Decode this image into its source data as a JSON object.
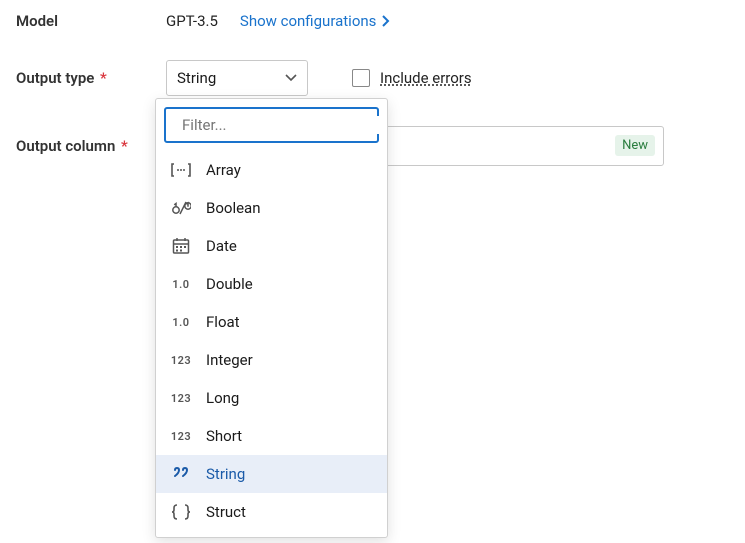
{
  "model": {
    "label": "Model",
    "name": "GPT-3.5",
    "show_config": "Show configurations"
  },
  "output_type": {
    "label": "Output type",
    "selected": "String"
  },
  "include_errors": {
    "label": "Include errors"
  },
  "output_column": {
    "label": "Output column",
    "badge": "New"
  },
  "dropdown": {
    "filter_placeholder": "Filter...",
    "options": [
      {
        "icon": "array",
        "label": "Array",
        "selected": false
      },
      {
        "icon": "boolean",
        "label": "Boolean",
        "selected": false
      },
      {
        "icon": "date",
        "label": "Date",
        "selected": false
      },
      {
        "icon": "num10",
        "label": "Double",
        "selected": false
      },
      {
        "icon": "num10",
        "label": "Float",
        "selected": false
      },
      {
        "icon": "num123",
        "label": "Integer",
        "selected": false
      },
      {
        "icon": "num123",
        "label": "Long",
        "selected": false
      },
      {
        "icon": "num123",
        "label": "Short",
        "selected": false
      },
      {
        "icon": "string",
        "label": "String",
        "selected": true
      },
      {
        "icon": "struct",
        "label": "Struct",
        "selected": false
      }
    ]
  }
}
